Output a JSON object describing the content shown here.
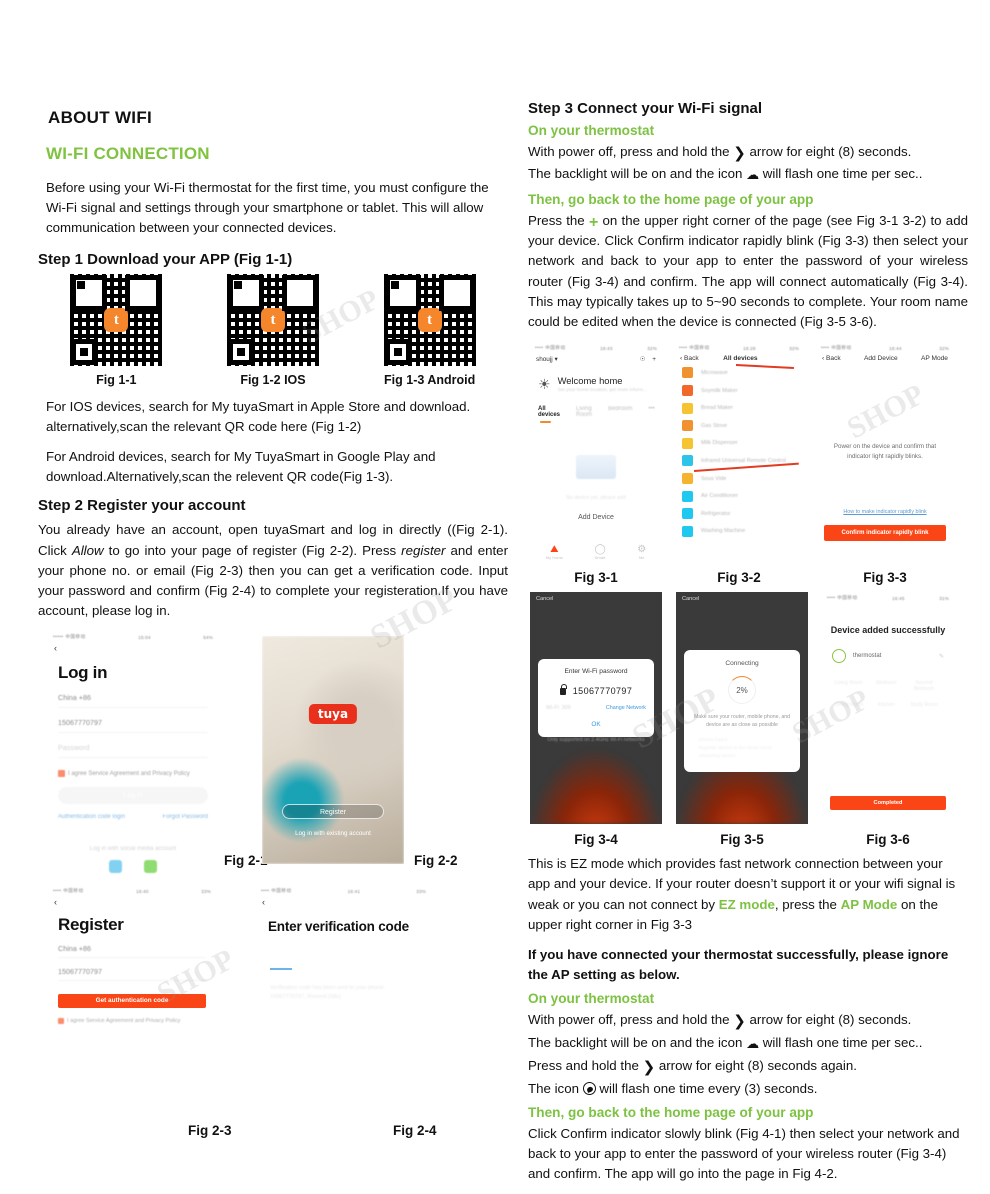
{
  "left": {
    "about_title": "ABOUT WIFI",
    "wifi_connection_title": "WI-FI CONNECTION",
    "intro": "Before using your Wi-Fi thermostat for the first time, you must configure the  Wi-Fi signal and settings through your smartphone or tablet. This will allow communication between your connected devices.",
    "step1_title": "Step 1 Download your APP  (Fig 1-1)",
    "qr_codes": [
      {
        "caption": "Fig 1-1",
        "logo": "t"
      },
      {
        "caption": "Fig 1-2 IOS",
        "logo": "t"
      },
      {
        "caption": "Fig 1-3 Android",
        "logo": "t"
      }
    ],
    "ios_note": "For IOS devices, search for My tuyaSmart in Apple Store and download. alternatively,scan the relevant QR code here  (Fig 1-2)",
    "android_note": "For Android devices, search for My TuyaSmart in Google Play and download.Alternatively,scan the relevent QR code(Fig 1-3).",
    "step2_title": "Step 2 Register your account",
    "step2_body_1": "You already have an account, open tuyaSmart and log in directly ((Fig 2-1). Click ",
    "step2_allow": "Allow",
    "step2_body_2": " to go into your page of register (Fig 2-2).  Press ",
    "step2_register": "register",
    "step2_body_3": " and enter your phone no. or email (Fig 2-3) then you can get a verification code. Input your password and confirm  (Fig 2-4) to complete your registeration.If you have account, please log in."
  },
  "fig21": {
    "caption": "Fig 2-1",
    "status_carrier": "••••• 中国移动",
    "status_time": "15:04",
    "status_battery": "54%",
    "title": "Log in",
    "country": "China +86",
    "phone": "15067770797",
    "password_placeholder": "Password",
    "agree_text": "I agree Service Agreement and Privacy Policy",
    "login_button": "Log in",
    "auth_link": "Authentication code login",
    "forgot_link": "Forgot Password",
    "social_label": "Log in with social media account",
    "social": [
      "QQ",
      "WeChat"
    ]
  },
  "fig22": {
    "caption": "Fig 2-2",
    "logo_text": "tuya",
    "register_button": "Register",
    "existing_account": "Log in with existing account"
  },
  "fig23": {
    "caption": "Fig 2-3",
    "status_carrier": "•••• 中国移动",
    "status_time": "16:40",
    "status_battery": "33%",
    "title": "Register",
    "country": "China +86",
    "phone": "15067770797",
    "auth_button": "Get authentication code",
    "agree_text": "I agree Service Agreement and Privacy Policy"
  },
  "fig24": {
    "caption": "Fig 2-4",
    "status_carrier": "•••• 中国移动",
    "status_time": "16:41",
    "status_battery": "33%",
    "title": "Enter verification code",
    "hint": "Verification code has been sent to your phone: 15067770797, Resend (58s)"
  },
  "right": {
    "step3_title": "Step 3 Connect your Wi-Fi signal",
    "on_thermostat": "On your thermostat",
    "thermo_line1_a": "With power off, press and hold the ",
    "thermo_line1_b": " arrow for eight (8) seconds.",
    "thermo_line2_a": "The backlight will be on and the icon ",
    "thermo_line2_b": " will flash one time per sec..",
    "go_back_home": "Then, go back to the home page of your app",
    "press_plus_a": "Press the ",
    "press_plus_b": " on the upper right corner of the page (see Fig 3-1 3-2) to add your device.  Click Confirm indicator rapidly blink (Fig 3-3) then select your network and back to your app to enter the password of your wireless router (Fig 3-4) and confirm. The app will connect automatically (Fig 3-4). This may typically takes up to 5~90 seconds to complete. Your room name could be edited when the device is connected (Fig 3-5 3-6).",
    "ez_para_1": "This is EZ mode which provides fast network connection between your app and your device. If your router doesn’t support it or your wifi signal is weak or you can not connect by ",
    "ez_mode": "EZ mode",
    "ez_para_2": ", press the ",
    "ap_mode": "AP Mode",
    "ez_para_3": " on the upper right corner in Fig 3-3",
    "ignore_ap": "If you have connected your thermostat successfully, please ignore the AP setting as below.",
    "ap_line3_a": "Press and hold the ",
    "ap_line3_b": " arrow for eight (8) seconds again.",
    "ap_line4_a": "The icon ",
    "ap_line4_b": " will flash one time every (3) seconds.",
    "final_para": "Click Confirm indicator slowly blink (Fig 4-1) then select your network and back to your app to enter the password of your wireless router (Fig 3-4) and confirm. The app will go into the page in Fig 4-2."
  },
  "fig31": {
    "caption": "Fig 3-1",
    "status_carrier": "•••• 中国移动",
    "status_time": "16:43",
    "status_battery": "32%",
    "home_name": "shoujj",
    "welcome_title": "Welcome home",
    "welcome_sub": "Set your home location, get more inform...",
    "tabs": [
      "All devices",
      "Living Room",
      "Bedroom",
      "•••"
    ],
    "empty_text": "No device yet, please add",
    "add_device": "Add Device",
    "nav": [
      "My Home",
      "Smart",
      "Me"
    ]
  },
  "fig32": {
    "caption": "Fig 3-2",
    "status_carrier": "•••• 中国移动",
    "status_time": "16:28",
    "status_battery": "32%",
    "back": "Back",
    "title": "All devices",
    "devices": [
      {
        "name": "Microwave",
        "color": "#f0922f"
      },
      {
        "name": "Soymilk Maker",
        "color": "#f2682a"
      },
      {
        "name": "Bread Maker",
        "color": "#f5c430"
      },
      {
        "name": "Gas Stove",
        "color": "#f0922f"
      },
      {
        "name": "Milk Dispenser",
        "color": "#f5c430"
      },
      {
        "name": "Infrared Universal Remote Control",
        "color": "#2ec4e8"
      },
      {
        "name": "Sous Vide",
        "color": "#f5b32f"
      },
      {
        "name": "Air Conditioner",
        "color": "#1ec8ee"
      },
      {
        "name": "Refrigerator",
        "color": "#1ec8ee"
      },
      {
        "name": "Washing Machine",
        "color": "#1ec8ee"
      }
    ]
  },
  "fig33": {
    "caption": "Fig 3-3",
    "status_carrier": "•••• 中国移动",
    "status_time": "16:44",
    "status_battery": "32%",
    "back": "Back",
    "title": "Add Device",
    "ap_mode": "AP Mode",
    "body": "Power on the device and confirm that indicator light rapidly blinks.",
    "help_link": "How to make indicator rapidly blink",
    "confirm_button": "Confirm indicator rapidly blink"
  },
  "fig34": {
    "caption": "Fig 3-4",
    "cancel": "Cancel",
    "title": "Enter Wi-Fi password",
    "password": "15067770797",
    "ssid": "Wi-Fi: 309",
    "change_network": "Change Network",
    "ok": "OK",
    "footer": "Only supported on 2.4GHz Wi-Fi networks"
  },
  "fig35": {
    "caption": "Fig 3-5",
    "cancel": "Cancel",
    "title": "Connecting",
    "percent": "2%",
    "message": "Make sure your router, mobile phone, and device are as close as possible",
    "steps": "Device found\nRegister device to the smart cloud\nInitializing device"
  },
  "fig36": {
    "caption": "Fig 3-6",
    "status_carrier": "•••• 中国移动",
    "status_time": "16:45",
    "status_battery": "31%",
    "title": "Device added successfully",
    "device_name": "thermostat",
    "rooms": [
      "Living Room",
      "Bedroom",
      "Second Bedroom",
      "Dining Room",
      "Kitchen",
      "Study Room"
    ],
    "completed_button": "Completed"
  },
  "watermarks": [
    "SHOP",
    "SHOP",
    "SHOP",
    "SHOP",
    "SHOP",
    "SHOP"
  ],
  "colors": {
    "green": "#7dc242",
    "orange": "#fa4616",
    "tuya_red": "#e8301c"
  }
}
